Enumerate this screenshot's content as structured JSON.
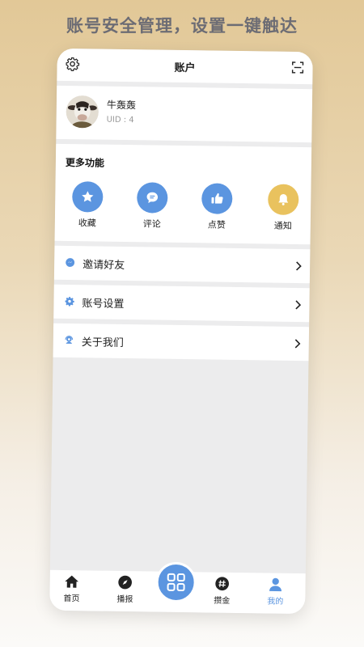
{
  "promo": {
    "headline": "账号安全管理，设置一键触达"
  },
  "header": {
    "title": "账户",
    "left_icon": "gear-icon",
    "right_icon": "scan-icon"
  },
  "profile": {
    "name": "牛轰轰",
    "uid": "UID : 4"
  },
  "features": {
    "title": "更多功能",
    "items": [
      {
        "label": "收藏",
        "icon": "star-icon",
        "color": "#5b95e0"
      },
      {
        "label": "评论",
        "icon": "comment-icon",
        "color": "#5b95e0"
      },
      {
        "label": "点赞",
        "icon": "thumbs-up-icon",
        "color": "#5b95e0"
      },
      {
        "label": "通知",
        "icon": "bell-icon",
        "color": "#e9c25e"
      }
    ]
  },
  "menu": [
    {
      "label": "邀请好友",
      "icon": "message-icon"
    },
    {
      "label": "账号设置",
      "icon": "settings-icon"
    },
    {
      "label": "关于我们",
      "icon": "support-icon"
    }
  ],
  "tabbar": {
    "tabs": [
      {
        "label": "首页",
        "icon": "home-icon"
      },
      {
        "label": "播报",
        "icon": "compass-icon"
      },
      {
        "label": "攒金",
        "icon": "hash-icon"
      },
      {
        "label": "我的",
        "icon": "user-icon",
        "active": true
      }
    ],
    "center_icon": "grid-icon",
    "accent_color": "#5b95e0"
  }
}
